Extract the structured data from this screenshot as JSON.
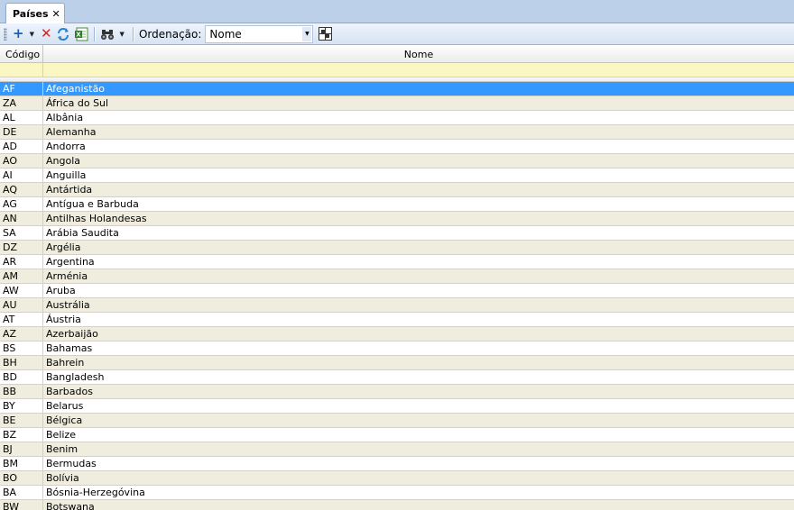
{
  "tab": {
    "title": "Países",
    "close_glyph": "✕"
  },
  "toolbar": {
    "add_icon": "plus-icon",
    "delete_icon": "delete-icon",
    "refresh_icon": "refresh-icon",
    "export_icon": "excel-export-icon",
    "find_icon": "binoculars-icon",
    "sort_label": "Ordenação:",
    "sort_value": "Nome",
    "layout_icon": "grid-layout-icon"
  },
  "grid": {
    "columns": [
      "Código",
      "Nome"
    ],
    "selected_index": 0,
    "rows": [
      {
        "code": "AF",
        "name": "Afeganistão"
      },
      {
        "code": "ZA",
        "name": "África do Sul"
      },
      {
        "code": "AL",
        "name": "Albânia"
      },
      {
        "code": "DE",
        "name": "Alemanha"
      },
      {
        "code": "AD",
        "name": "Andorra"
      },
      {
        "code": "AO",
        "name": "Angola"
      },
      {
        "code": "AI",
        "name": "Anguilla"
      },
      {
        "code": "AQ",
        "name": "Antártida"
      },
      {
        "code": "AG",
        "name": "Antígua e Barbuda"
      },
      {
        "code": "AN",
        "name": "Antilhas Holandesas"
      },
      {
        "code": "SA",
        "name": "Arábia Saudita"
      },
      {
        "code": "DZ",
        "name": "Argélia"
      },
      {
        "code": "AR",
        "name": "Argentina"
      },
      {
        "code": "AM",
        "name": "Arménia"
      },
      {
        "code": "AW",
        "name": "Aruba"
      },
      {
        "code": "AU",
        "name": "Austrália"
      },
      {
        "code": "AT",
        "name": "Áustria"
      },
      {
        "code": "AZ",
        "name": "Azerbaijão"
      },
      {
        "code": "BS",
        "name": "Bahamas"
      },
      {
        "code": "BH",
        "name": "Bahrein"
      },
      {
        "code": "BD",
        "name": "Bangladesh"
      },
      {
        "code": "BB",
        "name": "Barbados"
      },
      {
        "code": "BY",
        "name": "Belarus"
      },
      {
        "code": "BE",
        "name": "Bélgica"
      },
      {
        "code": "BZ",
        "name": "Belize"
      },
      {
        "code": "BJ",
        "name": "Benim"
      },
      {
        "code": "BM",
        "name": "Bermudas"
      },
      {
        "code": "BO",
        "name": "Bolívia"
      },
      {
        "code": "BA",
        "name": "Bósnia-Herzegóvina"
      },
      {
        "code": "BW",
        "name": "Botswana"
      }
    ]
  }
}
